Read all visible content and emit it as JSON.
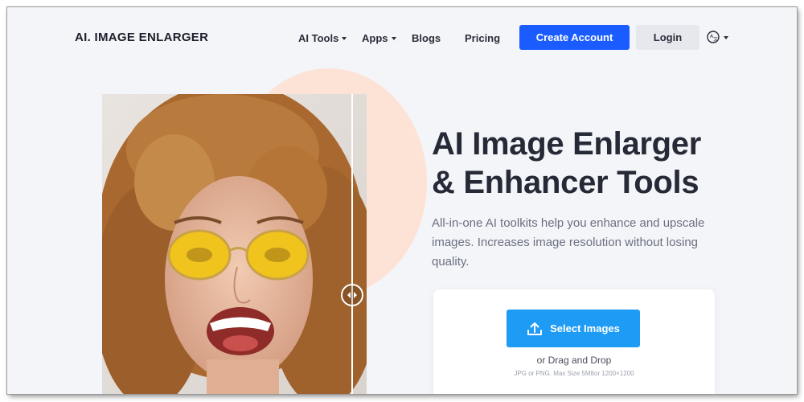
{
  "header": {
    "logo": "AI. IMAGE ENLARGER",
    "nav": [
      {
        "label": "AI Tools",
        "has_dropdown": true
      },
      {
        "label": "Apps",
        "has_dropdown": true
      },
      {
        "label": "Blogs",
        "has_dropdown": false
      },
      {
        "label": "Pricing",
        "has_dropdown": false
      }
    ],
    "create_account": "Create Account",
    "login": "Login",
    "language_icon": "globe-translate-icon"
  },
  "hero": {
    "title_line1": "AI Image Enlarger",
    "title_line2": "& Enhancer Tools",
    "subtitle": "All-in-one AI toolkits help you enhance and upscale images. Increases image resolution without losing quality."
  },
  "compare": {
    "image": "smiling-woman-with-yellow-sunglasses",
    "handle_icon": "left-right-arrows-icon"
  },
  "upload": {
    "button_label": "Select Images",
    "button_icon": "upload-icon",
    "drag_text": "or Drag and Drop",
    "hint": "JPG or PNG. Max Size 5M8or 1200×1200"
  },
  "colors": {
    "primary": "#1a5cff",
    "upload_button": "#1e9bf5",
    "background": "#f4f5f9",
    "accent_circle": "#fde3d6"
  }
}
